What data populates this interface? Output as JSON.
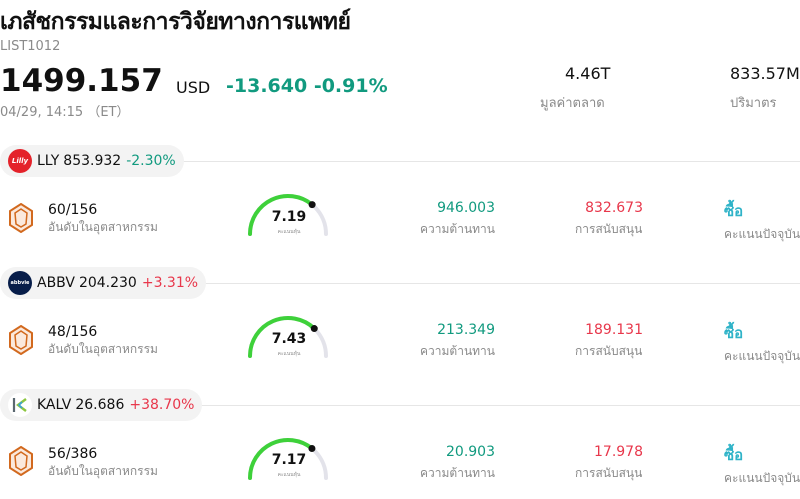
{
  "header": {
    "title": "เภสัชกรรมและการวิจัยทางการแพทย์",
    "code": "LIST1012",
    "price": "1499.157",
    "currency": "USD",
    "change": "-13.640 -0.91%",
    "time": "04/29, 14:15 （ET）",
    "market_cap_value": "4.46T",
    "market_cap_label": "มูลค่าตลาด",
    "volume_value": "833.57M",
    "volume_label": "ปริมาตร"
  },
  "colors": {
    "down": "#119a7f",
    "up": "#e8374b",
    "buy": "#2fb3c8",
    "gauge": "#3ed13a"
  },
  "stocks": [
    {
      "symbol": "LLY",
      "price": "853.932",
      "change": "-2.30%",
      "direction": "down",
      "logo_icon": "lilly-logo-icon",
      "logo_text": "Lilly",
      "logo_color": "#e4222a",
      "rank": "60/156",
      "rank_label": "อันดับในอุตสาหกรรม",
      "score": "7.19",
      "score_fraction": 0.719,
      "score_label": "คะแนนหุ้น",
      "resistance": "946.003",
      "resistance_label": "ความต้านทาน",
      "support": "832.673",
      "support_label": "การสนับสนุน",
      "rating": "ซื้อ",
      "rating_label": "คะแนนปัจจุบัน"
    },
    {
      "symbol": "ABBV",
      "price": "204.230",
      "change": "+3.31%",
      "direction": "up",
      "logo_icon": "abbvie-logo-icon",
      "logo_text": "abbvie",
      "logo_color": "#071d49",
      "rank": "48/156",
      "rank_label": "อันดับในอุตสาหกรรม",
      "score": "7.43",
      "score_fraction": 0.743,
      "score_label": "คะแนนหุ้น",
      "resistance": "213.349",
      "resistance_label": "ความต้านทาน",
      "support": "189.131",
      "support_label": "การสนับสนุน",
      "rating": "ซื้อ",
      "rating_label": "คะแนนปัจจุบัน"
    },
    {
      "symbol": "KALV",
      "price": "26.686",
      "change": "+38.70%",
      "direction": "up",
      "logo_icon": "kalvista-logo-icon",
      "logo_text": "K",
      "logo_color": "#ffffff",
      "rank": "56/386",
      "rank_label": "อันดับในอุตสาหกรรม",
      "score": "7.17",
      "score_fraction": 0.717,
      "score_label": "คะแนนหุ้น",
      "resistance": "20.903",
      "resistance_label": "ความต้านทาน",
      "support": "17.978",
      "support_label": "การสนับสนุน",
      "rating": "ซื้อ",
      "rating_label": "คะแนนปัจจุบัน"
    }
  ]
}
